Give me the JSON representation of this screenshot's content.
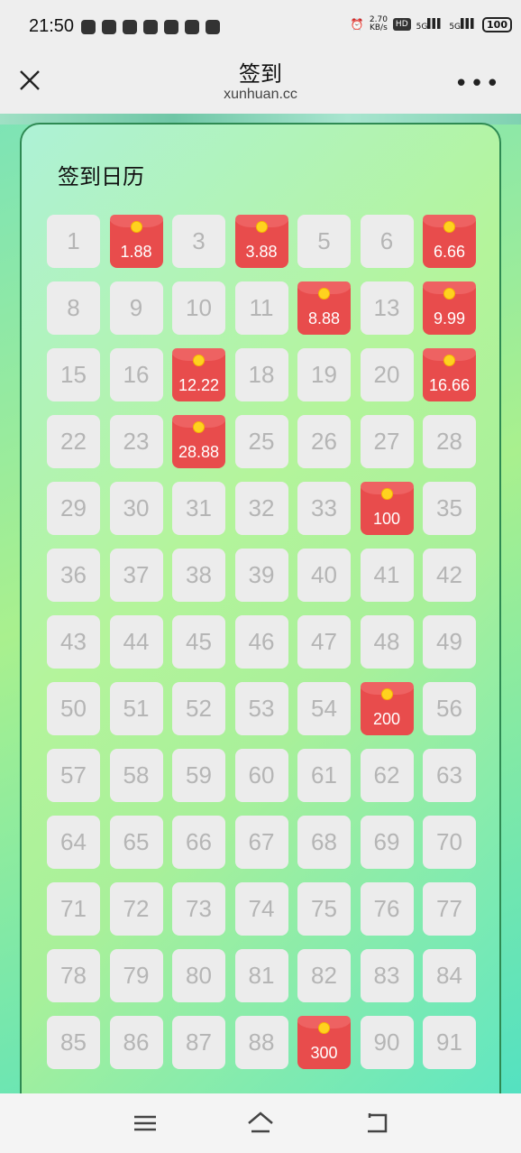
{
  "status_bar": {
    "time": "21:50",
    "net_speed_value": "2.70",
    "net_speed_unit": "KB/s",
    "hd": "HD",
    "sig1": "5G",
    "sig2": "5G",
    "battery": "100"
  },
  "nav": {
    "title": "签到",
    "domain": "xunhuan.cc"
  },
  "calendar": {
    "title": "签到日历",
    "days": [
      {
        "label": "1",
        "packet": false
      },
      {
        "label": "1.88",
        "packet": true
      },
      {
        "label": "3",
        "packet": false
      },
      {
        "label": "3.88",
        "packet": true
      },
      {
        "label": "5",
        "packet": false
      },
      {
        "label": "6",
        "packet": false
      },
      {
        "label": "6.66",
        "packet": true
      },
      {
        "label": "8",
        "packet": false
      },
      {
        "label": "9",
        "packet": false
      },
      {
        "label": "10",
        "packet": false
      },
      {
        "label": "11",
        "packet": false
      },
      {
        "label": "8.88",
        "packet": true
      },
      {
        "label": "13",
        "packet": false
      },
      {
        "label": "9.99",
        "packet": true
      },
      {
        "label": "15",
        "packet": false
      },
      {
        "label": "16",
        "packet": false
      },
      {
        "label": "12.22",
        "packet": true
      },
      {
        "label": "18",
        "packet": false
      },
      {
        "label": "19",
        "packet": false
      },
      {
        "label": "20",
        "packet": false
      },
      {
        "label": "16.66",
        "packet": true
      },
      {
        "label": "22",
        "packet": false
      },
      {
        "label": "23",
        "packet": false
      },
      {
        "label": "28.88",
        "packet": true
      },
      {
        "label": "25",
        "packet": false
      },
      {
        "label": "26",
        "packet": false
      },
      {
        "label": "27",
        "packet": false
      },
      {
        "label": "28",
        "packet": false
      },
      {
        "label": "29",
        "packet": false
      },
      {
        "label": "30",
        "packet": false
      },
      {
        "label": "31",
        "packet": false
      },
      {
        "label": "32",
        "packet": false
      },
      {
        "label": "33",
        "packet": false
      },
      {
        "label": "100",
        "packet": true
      },
      {
        "label": "35",
        "packet": false
      },
      {
        "label": "36",
        "packet": false
      },
      {
        "label": "37",
        "packet": false
      },
      {
        "label": "38",
        "packet": false
      },
      {
        "label": "39",
        "packet": false
      },
      {
        "label": "40",
        "packet": false
      },
      {
        "label": "41",
        "packet": false
      },
      {
        "label": "42",
        "packet": false
      },
      {
        "label": "43",
        "packet": false
      },
      {
        "label": "44",
        "packet": false
      },
      {
        "label": "45",
        "packet": false
      },
      {
        "label": "46",
        "packet": false
      },
      {
        "label": "47",
        "packet": false
      },
      {
        "label": "48",
        "packet": false
      },
      {
        "label": "49",
        "packet": false
      },
      {
        "label": "50",
        "packet": false
      },
      {
        "label": "51",
        "packet": false
      },
      {
        "label": "52",
        "packet": false
      },
      {
        "label": "53",
        "packet": false
      },
      {
        "label": "54",
        "packet": false
      },
      {
        "label": "200",
        "packet": true
      },
      {
        "label": "56",
        "packet": false
      },
      {
        "label": "57",
        "packet": false
      },
      {
        "label": "58",
        "packet": false
      },
      {
        "label": "59",
        "packet": false
      },
      {
        "label": "60",
        "packet": false
      },
      {
        "label": "61",
        "packet": false
      },
      {
        "label": "62",
        "packet": false
      },
      {
        "label": "63",
        "packet": false
      },
      {
        "label": "64",
        "packet": false
      },
      {
        "label": "65",
        "packet": false
      },
      {
        "label": "66",
        "packet": false
      },
      {
        "label": "67",
        "packet": false
      },
      {
        "label": "68",
        "packet": false
      },
      {
        "label": "69",
        "packet": false
      },
      {
        "label": "70",
        "packet": false
      },
      {
        "label": "71",
        "packet": false
      },
      {
        "label": "72",
        "packet": false
      },
      {
        "label": "73",
        "packet": false
      },
      {
        "label": "74",
        "packet": false
      },
      {
        "label": "75",
        "packet": false
      },
      {
        "label": "76",
        "packet": false
      },
      {
        "label": "77",
        "packet": false
      },
      {
        "label": "78",
        "packet": false
      },
      {
        "label": "79",
        "packet": false
      },
      {
        "label": "80",
        "packet": false
      },
      {
        "label": "81",
        "packet": false
      },
      {
        "label": "82",
        "packet": false
      },
      {
        "label": "83",
        "packet": false
      },
      {
        "label": "84",
        "packet": false
      },
      {
        "label": "85",
        "packet": false
      },
      {
        "label": "86",
        "packet": false
      },
      {
        "label": "87",
        "packet": false
      },
      {
        "label": "88",
        "packet": false
      },
      {
        "label": "300",
        "packet": true
      },
      {
        "label": "90",
        "packet": false
      },
      {
        "label": "91",
        "packet": false
      }
    ]
  },
  "colors": {
    "packet_red": "#e84c4c",
    "coin_gold": "#ffd21f",
    "card_border": "#2e8a53"
  },
  "icons": {
    "close": "close-icon",
    "more": "more-icon",
    "menu": "menu-icon",
    "home": "home-icon",
    "back": "back-icon"
  }
}
